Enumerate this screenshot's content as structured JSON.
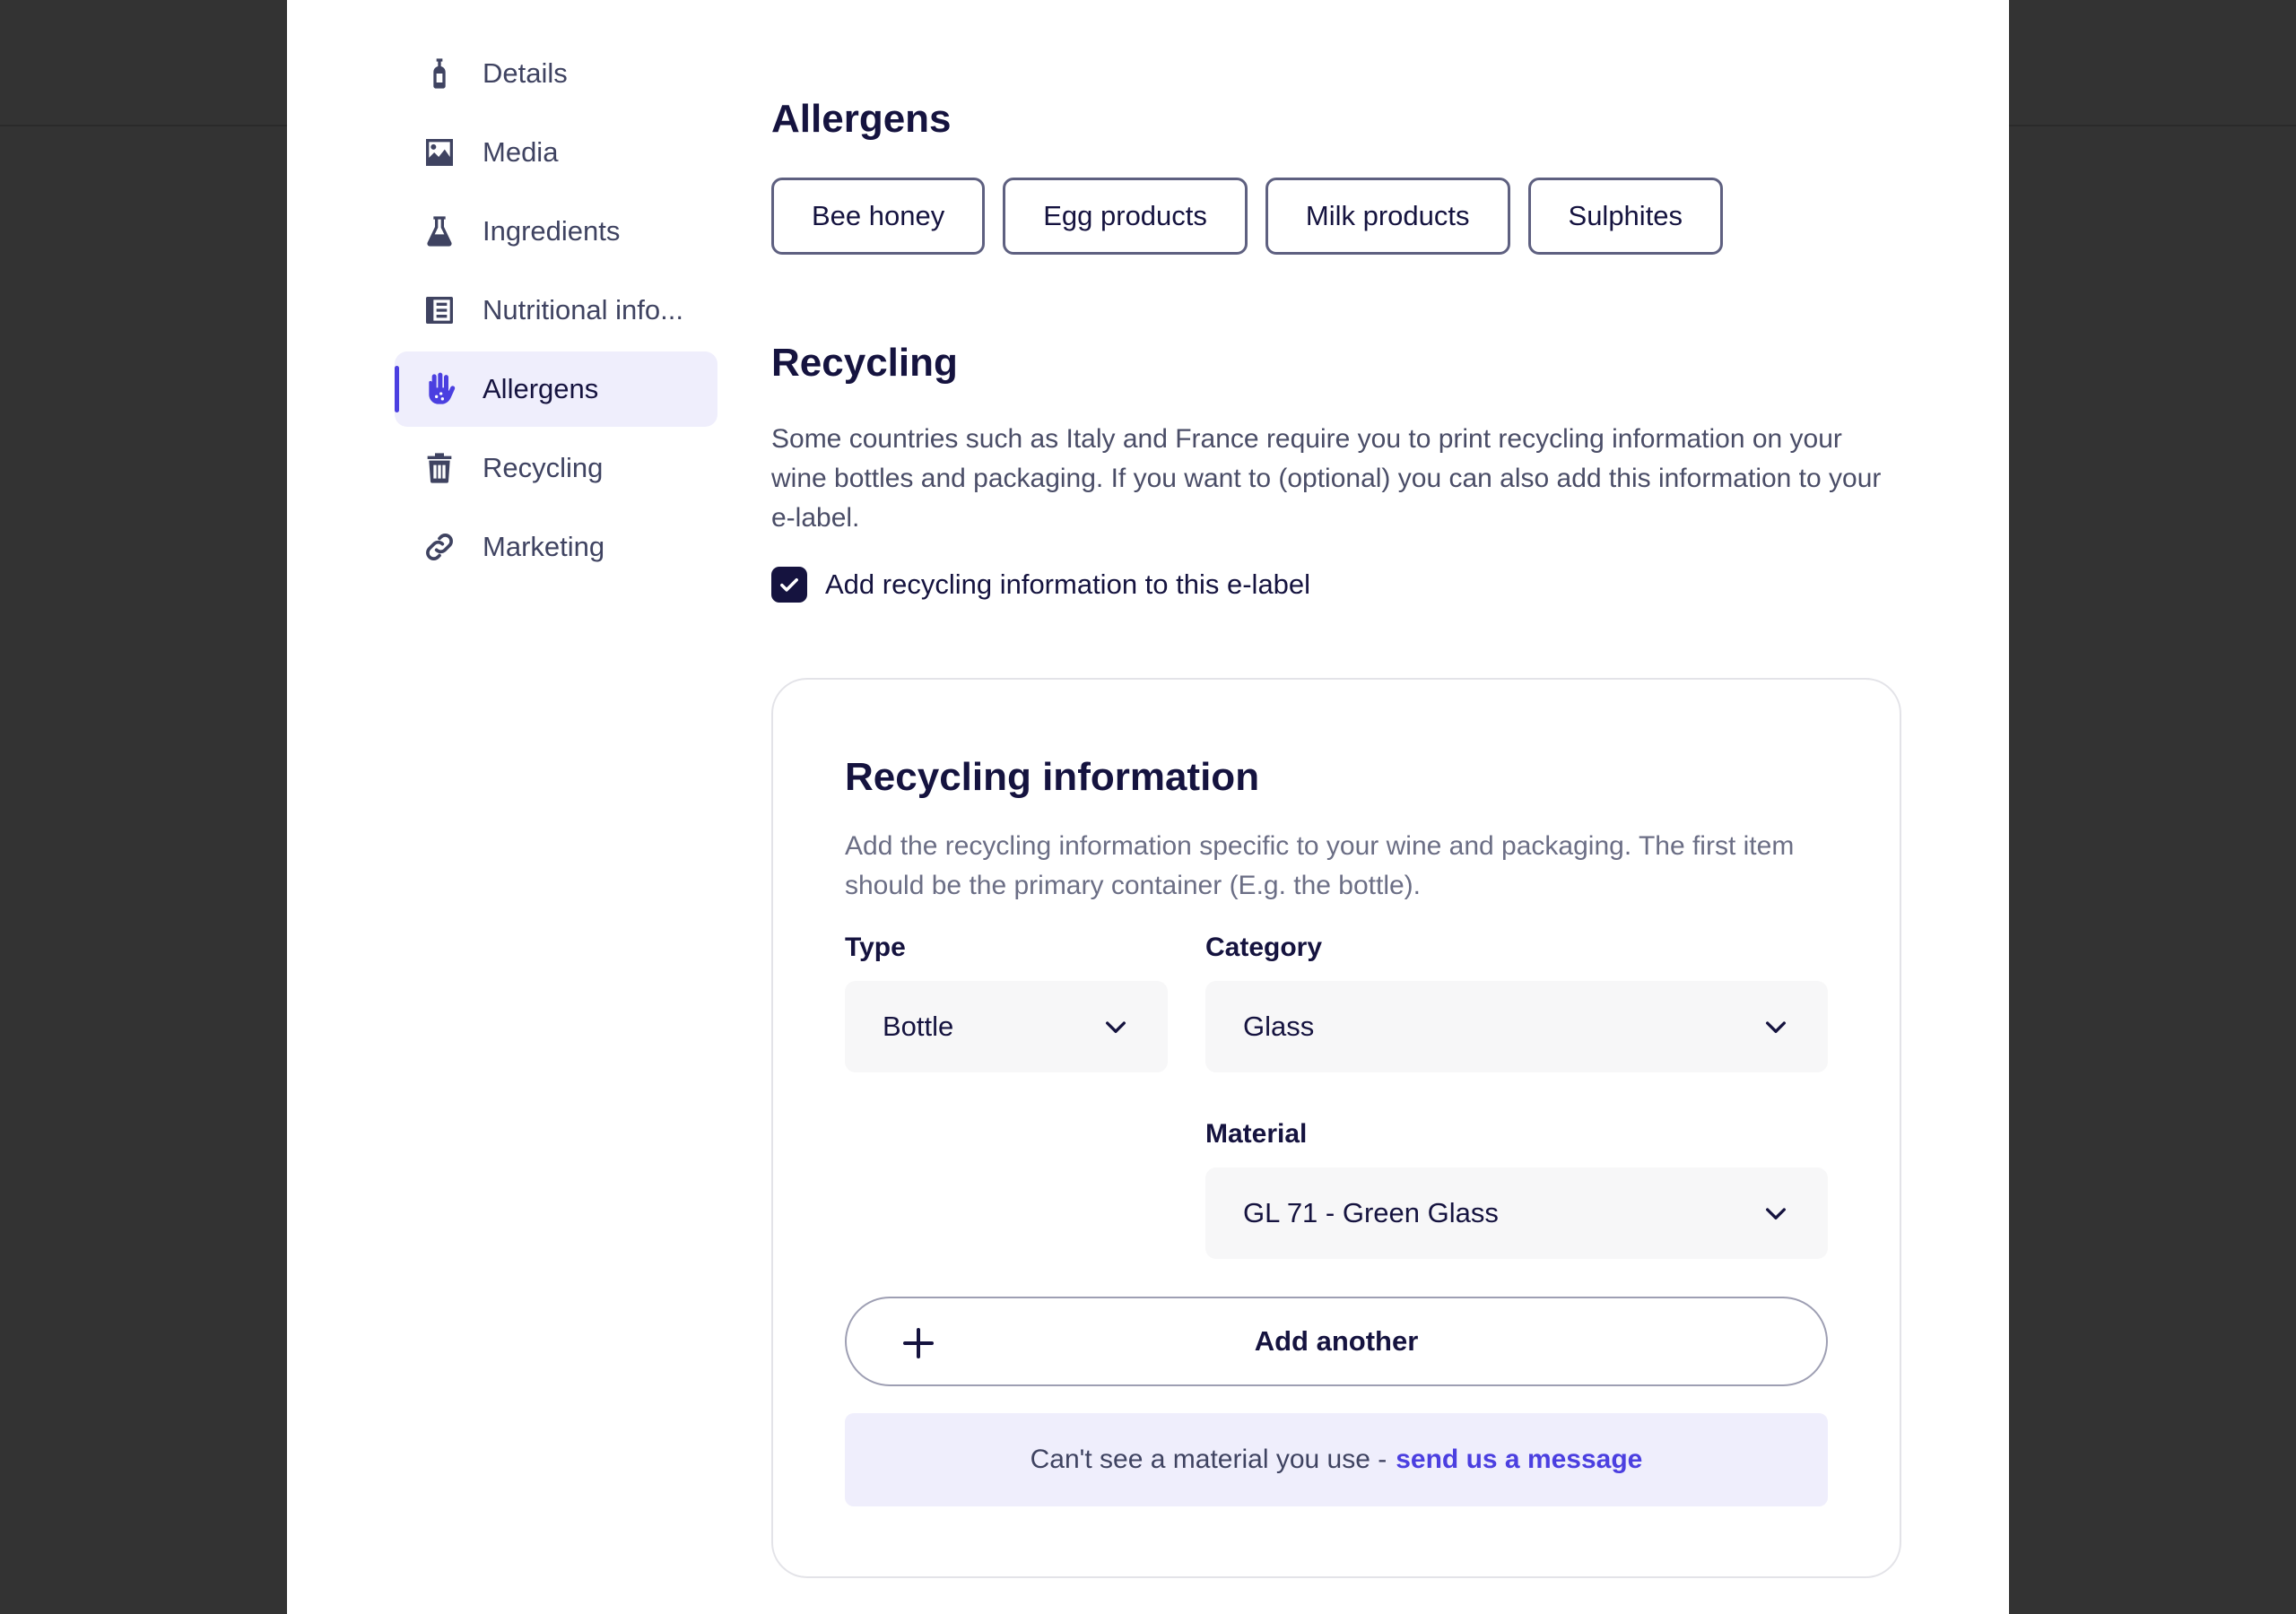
{
  "sidebar": {
    "items": [
      {
        "label": "Details",
        "icon": "bottle-icon"
      },
      {
        "label": "Media",
        "icon": "image-icon"
      },
      {
        "label": "Ingredients",
        "icon": "flask-icon"
      },
      {
        "label": "Nutritional info...",
        "icon": "list-icon"
      },
      {
        "label": "Allergens",
        "icon": "hand-icon",
        "active": true
      },
      {
        "label": "Recycling",
        "icon": "trash-icon"
      },
      {
        "label": "Marketing",
        "icon": "link-icon"
      }
    ]
  },
  "allergens": {
    "title": "Allergens",
    "chips": [
      "Bee honey",
      "Egg products",
      "Milk products",
      "Sulphites"
    ]
  },
  "recycling": {
    "title": "Recycling",
    "description": "Some countries such as Italy and France require you to print recycling information on your wine bottles and packaging. If you want to (optional) you can also add this information to your e-label.",
    "checkbox_label": "Add recycling information to this e-label",
    "checkbox_checked": true
  },
  "recycling_info": {
    "title": "Recycling information",
    "description": "Add the recycling information specific to your wine and packaging. The first item should be the primary container (E.g. the bottle).",
    "type_label": "Type",
    "type_value": "Bottle",
    "category_label": "Category",
    "category_value": "Glass",
    "material_label": "Material",
    "material_value": "GL 71 - Green Glass",
    "add_another_label": "Add another",
    "notice_text": "Can't see a material you use -",
    "notice_link": "send us a message"
  },
  "colors": {
    "accent": "#4b3fe0",
    "navy": "#15133f",
    "active_bg": "#efeefc"
  }
}
